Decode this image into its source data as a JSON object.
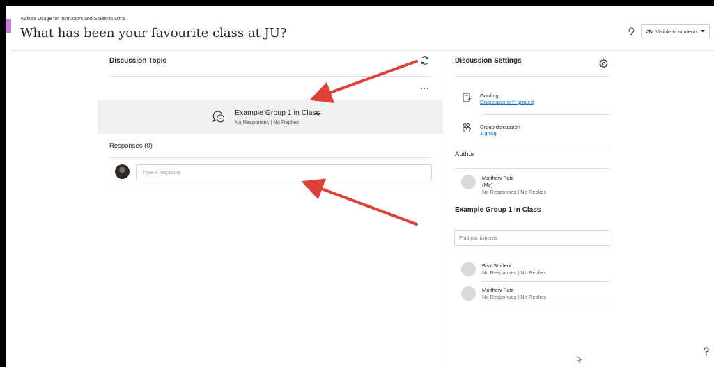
{
  "header": {
    "breadcrumb": "Kaltura Usage for Instructors and Students Ultra",
    "title": "What has been your favourite class at JU?",
    "visibility_label": "Visible to students"
  },
  "topic": {
    "heading": "Discussion Topic",
    "more_label": "...",
    "group_name": "Example Group 1 in Class",
    "group_stats": "No Responses | No Replies"
  },
  "responses": {
    "heading": "Responses (0)",
    "placeholder": "Type a response"
  },
  "settings": {
    "heading": "Discussion Settings",
    "grading_title": "Grading",
    "grading_link": "Discussion isn't graded",
    "group_title": "Group discussion",
    "group_link": "1 group"
  },
  "author": {
    "heading": "Author",
    "name": "Matthew Pate",
    "me": "(Me)",
    "stats": "No Responses | No Replies"
  },
  "group_panel": {
    "heading": "Example Group 1 in Class",
    "find_placeholder": "Find participants",
    "participants": [
      {
        "name": "Bisk Student",
        "stats": "No Responses | No Replies"
      },
      {
        "name": "Matthew Pate",
        "stats": "No Responses | No Replies"
      }
    ]
  },
  "colors": {
    "accent": "#c87dd6",
    "link": "#1f6fbf",
    "annotation_arrow": "#e0403a"
  }
}
